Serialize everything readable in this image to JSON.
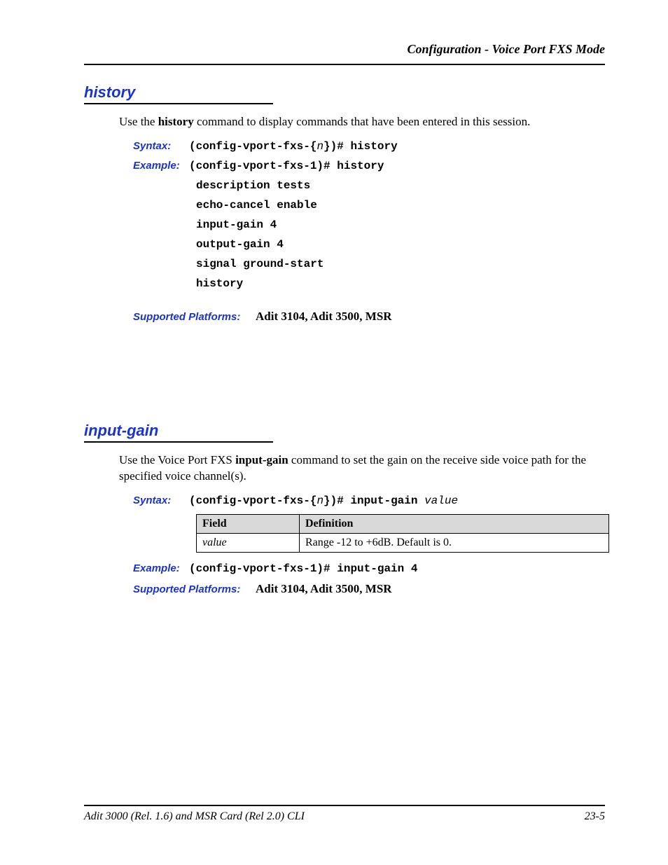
{
  "header": {
    "running_head": "Configuration - Voice Port FXS Mode"
  },
  "sections": {
    "history": {
      "title": "history",
      "intro_pre": "Use the ",
      "intro_bold": "history",
      "intro_post": " command to display commands that have been entered in this session.",
      "syntax_label": "Syntax:",
      "syntax_pre": "(config-vport-fxs-{",
      "syntax_param": "n",
      "syntax_post": "})# history",
      "example_label": "Example:",
      "example_cmd": "(config-vport-fxs-1)# history",
      "output": [
        "description tests",
        "echo-cancel enable",
        "input-gain 4",
        "output-gain 4",
        "signal ground-start",
        "history"
      ],
      "platforms_label": "Supported Platforms:",
      "platforms_value": "Adit 3104, Adit 3500, MSR"
    },
    "input_gain": {
      "title": "input-gain",
      "intro_pre": "Use the Voice Port FXS ",
      "intro_bold": "input-gain",
      "intro_post": " command to set the gain on the receive side voice path for the specified voice channel(s).",
      "syntax_label": "Syntax:",
      "syntax_pre": "(config-vport-fxs-{",
      "syntax_param": "n",
      "syntax_post": "})# input-gain ",
      "syntax_param2": "value",
      "table": {
        "head_field": "Field",
        "head_def": "Definition",
        "row_field": "value",
        "row_def": "Range -12 to +6dB. Default is 0."
      },
      "example_label": "Example:",
      "example_cmd": "(config-vport-fxs-1)# input-gain 4",
      "platforms_label": "Supported Platforms:",
      "platforms_value": "Adit 3104, Adit 3500, MSR"
    }
  },
  "footer": {
    "left": "Adit 3000 (Rel. 1.6) and MSR Card (Rel 2.0) CLI",
    "right": "23-5"
  }
}
